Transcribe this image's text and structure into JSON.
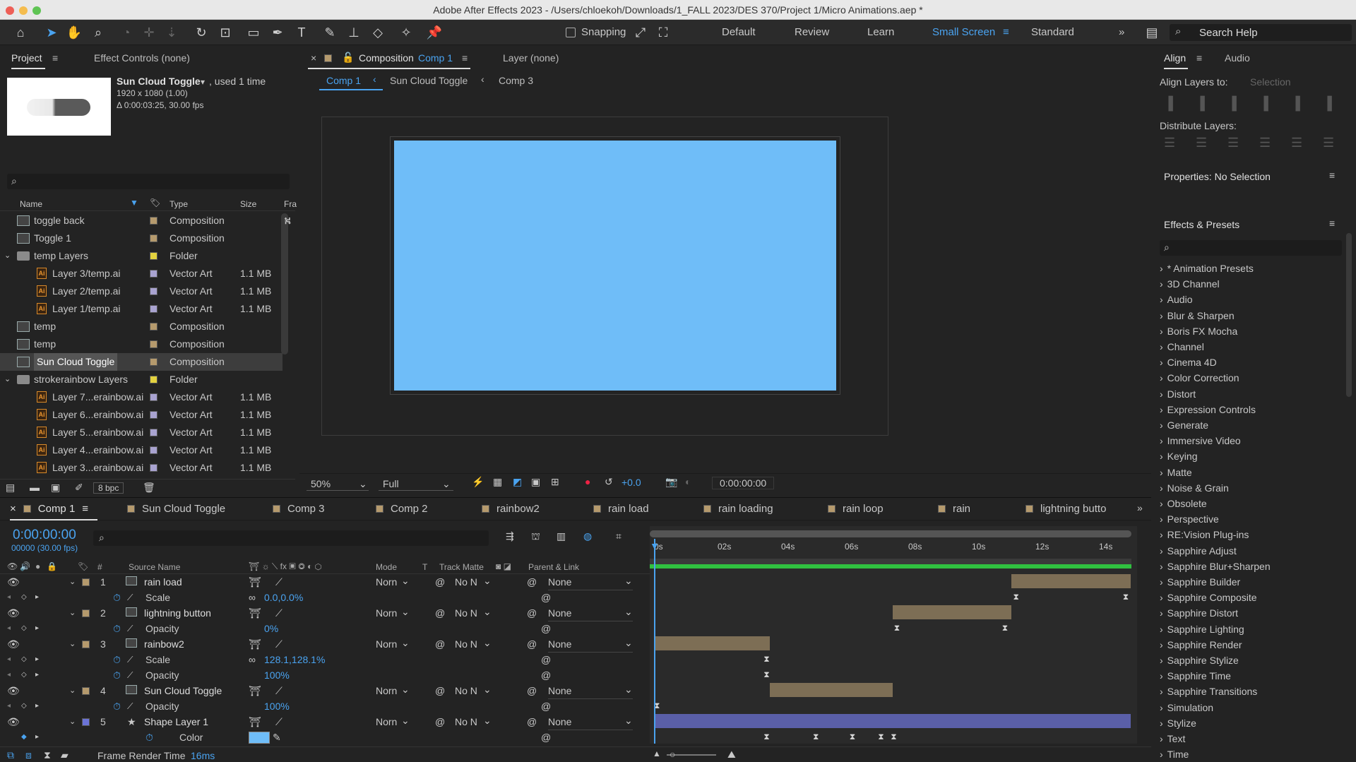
{
  "window": {
    "title": "Adobe After Effects 2023 - /Users/chloekoh/Downloads/1_FALL 2023/DES 370/Project 1/Micro Animations.aep *"
  },
  "toolbar": {
    "snapping_label": "Snapping",
    "workspaces": [
      "Default",
      "Review",
      "Learn",
      "Small Screen",
      "Standard"
    ],
    "active_workspace": "Small Screen",
    "search_help": "Search Help"
  },
  "project_panel": {
    "tab_project": "Project",
    "tab_effect_controls": "Effect Controls (none)",
    "selected_name": "Sun Cloud Toggle",
    "used": ", used 1 time",
    "dims": "1920 x 1080 (1.00)",
    "duration": "Δ 0:00:03:25, 30.00 fps",
    "columns": {
      "name": "Name",
      "type": "Type",
      "size": "Size",
      "frame": "Fra"
    },
    "items": [
      {
        "name": "toggle back",
        "type": "Composition",
        "size": "",
        "kind": "comp",
        "color": "#b59a6d",
        "indent": 0
      },
      {
        "name": "Toggle 1",
        "type": "Composition",
        "size": "",
        "kind": "comp",
        "color": "#b59a6d",
        "indent": 0
      },
      {
        "name": "temp Layers",
        "type": "Folder",
        "size": "",
        "kind": "folder",
        "color": "#e3d23f",
        "indent": 0
      },
      {
        "name": "Layer 3/temp.ai",
        "type": "Vector Art",
        "size": "1.1 MB",
        "kind": "ai",
        "color": "#a9a3d0",
        "indent": 1
      },
      {
        "name": "Layer 2/temp.ai",
        "type": "Vector Art",
        "size": "1.1 MB",
        "kind": "ai",
        "color": "#a9a3d0",
        "indent": 1
      },
      {
        "name": "Layer 1/temp.ai",
        "type": "Vector Art",
        "size": "1.1 MB",
        "kind": "ai",
        "color": "#a9a3d0",
        "indent": 1
      },
      {
        "name": "temp",
        "type": "Composition",
        "size": "",
        "kind": "comp",
        "color": "#b59a6d",
        "indent": 0
      },
      {
        "name": "temp",
        "type": "Composition",
        "size": "",
        "kind": "comp",
        "color": "#b59a6d",
        "indent": 0
      },
      {
        "name": "Sun Cloud Toggle",
        "type": "Composition",
        "size": "",
        "kind": "comp",
        "color": "#b59a6d",
        "indent": 0
      },
      {
        "name": "strokerainbow Layers",
        "type": "Folder",
        "size": "",
        "kind": "folder",
        "color": "#e3d23f",
        "indent": 0
      },
      {
        "name": "Layer 7...erainbow.ai",
        "type": "Vector Art",
        "size": "1.1 MB",
        "kind": "ai",
        "color": "#a9a3d0",
        "indent": 1
      },
      {
        "name": "Layer 6...erainbow.ai",
        "type": "Vector Art",
        "size": "1.1 MB",
        "kind": "ai",
        "color": "#a9a3d0",
        "indent": 1
      },
      {
        "name": "Layer 5...erainbow.ai",
        "type": "Vector Art",
        "size": "1.1 MB",
        "kind": "ai",
        "color": "#a9a3d0",
        "indent": 1
      },
      {
        "name": "Layer 4...erainbow.ai",
        "type": "Vector Art",
        "size": "1.1 MB",
        "kind": "ai",
        "color": "#a9a3d0",
        "indent": 1
      },
      {
        "name": "Layer 3...erainbow.ai",
        "type": "Vector Art",
        "size": "1.1 MB",
        "kind": "ai",
        "color": "#a9a3d0",
        "indent": 1
      }
    ],
    "bpc": "8 bpc"
  },
  "comp_viewer": {
    "tab_label": "Composition",
    "tab_comp": "Comp 1",
    "layer_tab": "Layer (none)",
    "breadcrumbs": [
      "Comp 1",
      "Sun Cloud Toggle",
      "Comp 3"
    ],
    "zoom": "50%",
    "resolution": "Full",
    "exposure": "+0.0",
    "timecode": "0:00:00:00",
    "canvas_color": "#6fbdf8"
  },
  "align_panel": {
    "tab_align": "Align",
    "tab_audio": "Audio",
    "align_to_label": "Align Layers to:",
    "align_to_value": "Selection",
    "distribute_label": "Distribute Layers:"
  },
  "properties_panel": {
    "title": "Properties: No Selection"
  },
  "effects_panel": {
    "title": "Effects & Presets",
    "items": [
      "* Animation Presets",
      "3D Channel",
      "Audio",
      "Blur & Sharpen",
      "Boris FX Mocha",
      "Channel",
      "Cinema 4D",
      "Color Correction",
      "Distort",
      "Expression Controls",
      "Generate",
      "Immersive Video",
      "Keying",
      "Matte",
      "Noise & Grain",
      "Obsolete",
      "Perspective",
      "RE:Vision Plug-ins",
      "Sapphire Adjust",
      "Sapphire Blur+Sharpen",
      "Sapphire Builder",
      "Sapphire Composite",
      "Sapphire Distort",
      "Sapphire Lighting",
      "Sapphire Render",
      "Sapphire Stylize",
      "Sapphire Time",
      "Sapphire Transitions",
      "Simulation",
      "Stylize",
      "Text",
      "Time"
    ]
  },
  "timeline": {
    "tabs": [
      {
        "label": "Comp 1",
        "color": "#b59a6d"
      },
      {
        "label": "Sun Cloud Toggle",
        "color": "#b59a6d"
      },
      {
        "label": "Comp 3",
        "color": "#b59a6d"
      },
      {
        "label": "Comp 2",
        "color": "#b59a6d"
      },
      {
        "label": "rainbow2",
        "color": "#b59a6d"
      },
      {
        "label": "rain load",
        "color": "#b59a6d"
      },
      {
        "label": "rain loading",
        "color": "#b59a6d"
      },
      {
        "label": "rain loop",
        "color": "#b59a6d"
      },
      {
        "label": "rain",
        "color": "#b59a6d"
      },
      {
        "label": "lightning butto",
        "color": "#b59a6d"
      }
    ],
    "timecode": "0:00:00:00",
    "frame_info": "00000 (30.00 fps)",
    "columns": {
      "num": "#",
      "source": "Source Name",
      "mode": "Mode",
      "t": "T",
      "track_matte": "Track Matte",
      "parent": "Parent & Link"
    },
    "ruler": [
      "0s",
      "02s",
      "04s",
      "06s",
      "08s",
      "10s",
      "12s",
      "14s"
    ],
    "layers": [
      {
        "num": "1",
        "name": "rain load",
        "mode": "Norn",
        "matte": "No N",
        "parent": "None",
        "color": "#b59a6d",
        "prop": "Scale",
        "value": "0.0,0.0%"
      },
      {
        "num": "2",
        "name": "lightning button",
        "mode": "Norn",
        "matte": "No N",
        "parent": "None",
        "color": "#b59a6d",
        "prop": "Opacity",
        "value": "0%"
      },
      {
        "num": "3",
        "name": "rainbow2",
        "mode": "Norn",
        "matte": "No N",
        "parent": "None",
        "color": "#b59a6d",
        "prop": "Scale",
        "value": "128.1,128.1%",
        "prop2": "Opacity",
        "value2": "100%"
      },
      {
        "num": "4",
        "name": "Sun Cloud Toggle",
        "mode": "Norn",
        "matte": "No N",
        "parent": "None",
        "color": "#b59a6d",
        "prop": "Opacity",
        "value": "100%"
      },
      {
        "num": "5",
        "name": "Shape Layer 1",
        "mode": "Norn",
        "matte": "No N",
        "parent": "None",
        "color": "#6b73d6",
        "prop": "Color",
        "value": ""
      }
    ],
    "frame_render_label": "Frame Render Time",
    "frame_render_value": "16ms"
  }
}
